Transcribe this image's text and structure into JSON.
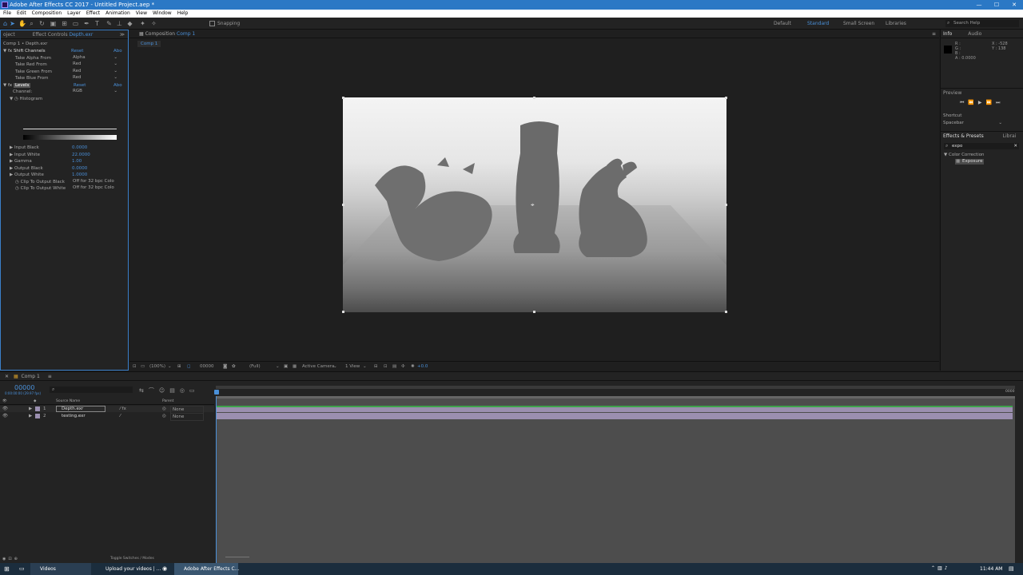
{
  "window": {
    "title": "Adobe After Effects CC 2017 - Untitled Project.aep *",
    "controls": [
      "—",
      "☐",
      "✕"
    ]
  },
  "menu": [
    "File",
    "Edit",
    "Composition",
    "Layer",
    "Effect",
    "Animation",
    "View",
    "Window",
    "Help"
  ],
  "toolbar": {
    "snapping": "Snapping",
    "workspaces": [
      "Default",
      "Standard",
      "Small Screen",
      "Libraries"
    ],
    "search_placeholder": "Search Help"
  },
  "left_panel": {
    "tab_project": "oject",
    "tab_effect_controls": "Effect Controls",
    "tab_effect_controls_file": "Depth.exr",
    "breadcrumb": "Comp 1 • Depth.exr",
    "effects": [
      {
        "name": "Shift Channels",
        "reset": "Reset",
        "about": "Abo",
        "params": [
          {
            "label": "Take Alpha From",
            "value": "Alpha"
          },
          {
            "label": "Take Red From",
            "value": "Red"
          },
          {
            "label": "Take Green From",
            "value": "Red"
          },
          {
            "label": "Take Blue From",
            "value": "Red"
          }
        ]
      },
      {
        "name": "Levels",
        "reset": "Reset",
        "about": "Abo",
        "channel_label": "Channel:",
        "channel_value": "RGB",
        "histogram_label": "Histogram",
        "params": [
          {
            "label": "Input Black",
            "value": "0.0000"
          },
          {
            "label": "Input White",
            "value": "22.0000"
          },
          {
            "label": "Gamma",
            "value": "1.00"
          },
          {
            "label": "Output Black",
            "value": "0.0000"
          },
          {
            "label": "Output White",
            "value": "1.0000"
          }
        ],
        "clip_params": [
          {
            "label": "Clip To Output Black",
            "value": "Off for 32 bpc Colo"
          },
          {
            "label": "Clip To Output White",
            "value": "Off for 32 bpc Colo"
          }
        ]
      }
    ]
  },
  "composition": {
    "tab_label": "Composition",
    "tab_comp": "Comp 1",
    "sub_tab": "Comp 1",
    "bottom": {
      "zoom": "(100%)",
      "timecode": "00000",
      "resolution": "(Full)",
      "camera": "Active Camera",
      "views": "1 View",
      "exposure": "+0.0"
    }
  },
  "right_panel": {
    "info_tab": "Info",
    "audio_tab": "Audio",
    "info_rows": [
      "R :",
      "G :",
      "B :",
      "A : 0.0000"
    ],
    "coords": [
      "X : -528",
      "Y : 138"
    ],
    "preview_tab": "Preview",
    "shortcut_label": "Shortcut",
    "shortcut_value": "Spacebar",
    "effects_presets_tab": "Effects & Presets",
    "libraries_tab": "Librai",
    "search_value": "expo",
    "category": "Color Correction",
    "result": "Exposure"
  },
  "timeline": {
    "tab": "Comp 1",
    "timecode": "00000",
    "timecode_sub": "0:00:00:00 (29.97 fps)",
    "columns": {
      "source": "Source Name",
      "parent": "Parent"
    },
    "layers": [
      {
        "num": "1",
        "name": "Depth.exr",
        "parent": "None"
      },
      {
        "num": "2",
        "name": "testing.exr",
        "parent": "None"
      }
    ],
    "footer": "Toggle Switches / Modes",
    "end_marker": "0000"
  },
  "taskbar": {
    "items": [
      "Videos",
      "Upload your videos | ...",
      "Adobe After Effects C..."
    ],
    "time": "11:44 AM"
  },
  "colors": {
    "accent": "#2b78c5",
    "link": "#4a90d9",
    "layer_bar": "#9b8fb0"
  }
}
